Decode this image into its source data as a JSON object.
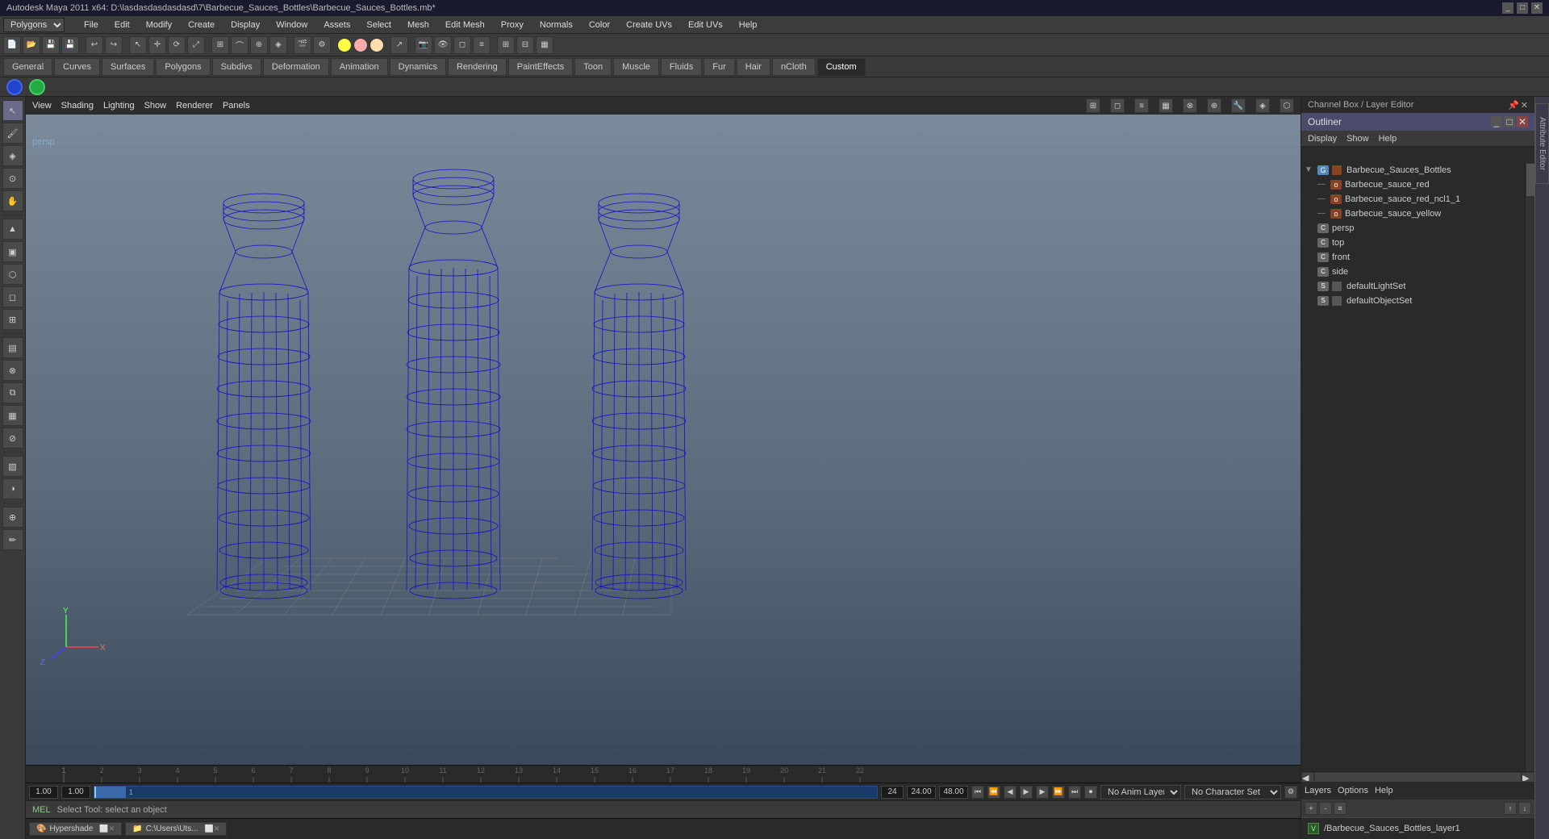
{
  "window": {
    "title": "Autodesk Maya 2011 x64: D:\\lasdasdasdasdasd\\7\\Barbecue_Sauces_Bottles\\Barbecue_Sauces_Bottles.mb*",
    "controls": [
      "_",
      "□",
      "✕"
    ]
  },
  "menubar": {
    "items": [
      "File",
      "Edit",
      "Modify",
      "Create",
      "Display",
      "Window",
      "Assets",
      "Select",
      "Mesh",
      "Edit Mesh",
      "Proxy",
      "Normals",
      "Color",
      "Create UVs",
      "Edit UVs",
      "Help"
    ]
  },
  "mode_selector": "Polygons",
  "tabs": {
    "items": [
      "General",
      "Curves",
      "Surfaces",
      "Polygons",
      "Subdivs",
      "Deformation",
      "Animation",
      "Dynamics",
      "Rendering",
      "PaintEffects",
      "Toon",
      "Muscle",
      "Fluids",
      "Fur",
      "Hair",
      "nCloth",
      "Custom"
    ],
    "active": "Custom"
  },
  "viewport_menu": {
    "items": [
      "View",
      "Shading",
      "Lighting",
      "Show",
      "Renderer",
      "Panels"
    ]
  },
  "left_toolbar": {
    "tools": [
      "↖",
      "✋",
      "↔",
      "↕",
      "⟳",
      "◈",
      "✏",
      "◻",
      "⬡",
      "⊕",
      "⊞",
      "≡",
      "⊟",
      "▣",
      "⊙",
      "◑",
      "▤",
      "⊗",
      "⧉",
      "▦",
      "⊘",
      "▧"
    ]
  },
  "outliner": {
    "title": "Outliner",
    "menu_items": [
      "Display",
      "Show",
      "Help"
    ],
    "items": [
      {
        "name": "Barbecue_Sauces_Bottles",
        "indent": 0,
        "expanded": true,
        "type": "group"
      },
      {
        "name": "Barbecue_sauce_red",
        "indent": 1,
        "expanded": false,
        "type": "mesh"
      },
      {
        "name": "Barbecue_sauce_red_ncl1_1",
        "indent": 1,
        "expanded": false,
        "type": "mesh"
      },
      {
        "name": "Barbecue_sauce_yellow",
        "indent": 1,
        "expanded": false,
        "type": "mesh"
      },
      {
        "name": "persp",
        "indent": 0,
        "expanded": false,
        "type": "camera"
      },
      {
        "name": "top",
        "indent": 0,
        "expanded": false,
        "type": "camera"
      },
      {
        "name": "front",
        "indent": 0,
        "expanded": false,
        "type": "camera"
      },
      {
        "name": "side",
        "indent": 0,
        "expanded": false,
        "type": "camera"
      },
      {
        "name": "defaultLightSet",
        "indent": 0,
        "expanded": false,
        "type": "set"
      },
      {
        "name": "defaultObjectSet",
        "indent": 0,
        "expanded": false,
        "type": "set"
      }
    ]
  },
  "channel_box": {
    "title": "Channel Box / Layer Editor"
  },
  "layers": {
    "header": [
      "Layers",
      "Options",
      "Help"
    ],
    "items": [
      {
        "v": "V",
        "name": "/Barbecue_Sauces_Bottles_layer1"
      }
    ]
  },
  "timeline": {
    "ticks": [
      1,
      2,
      3,
      4,
      5,
      6,
      7,
      8,
      9,
      10,
      11,
      12,
      13,
      14,
      15,
      16,
      17,
      18,
      19,
      20,
      21,
      22
    ],
    "current": "1.00"
  },
  "anim": {
    "start": "1.00",
    "current": "1.00",
    "marker": "1",
    "range_end": "24",
    "end": "24.00",
    "end2": "48.00",
    "anim_layer": "No Anim Layer",
    "char_set": "No Character Set"
  },
  "playback": {
    "buttons": [
      "⏮",
      "⏪",
      "⏹",
      "▶",
      "⏩",
      "⏭",
      "⏺"
    ]
  },
  "status": {
    "mode": "MEL",
    "message": "Select Tool: select an object"
  },
  "taskbar": {
    "items": [
      {
        "label": "Hypershade",
        "icon": "🎨"
      },
      {
        "label": "C:\\Users\\Uts...",
        "icon": "📁"
      }
    ]
  },
  "viewport": {
    "label": "persp"
  },
  "colors": {
    "accent_blue": "#4488cc",
    "bg_dark": "#2a2a2a",
    "bg_mid": "#3a3a3a",
    "bg_light": "#4a4a4a",
    "bottle_wire": "#0000cc",
    "grid_wire": "#aaaaaa",
    "viewport_bg_top": "#7a8a9a",
    "viewport_bg_bottom": "#3a4a5a",
    "tab_custom_bg": "#6a5a3a",
    "tab_custom_color": "#ffcc88"
  }
}
